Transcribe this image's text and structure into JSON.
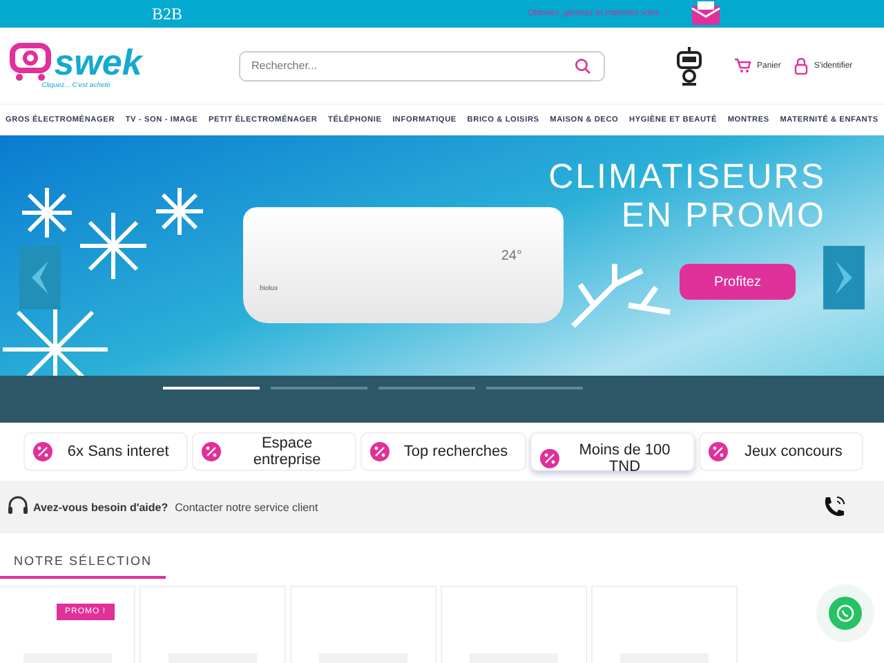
{
  "top_bar": {
    "b2b": "B2B",
    "promo_text": "Obtenez, générez et imprimez votre ..."
  },
  "header": {
    "logo": "swek",
    "tagline": "Cliquez... C'est acheté",
    "search": {
      "placeholder": "Rechercher..."
    },
    "cart": "Panier",
    "login": "S'identifier"
  },
  "nav": [
    "GROS ÉLECTROMÉNAGER",
    "TV - SON - IMAGE",
    "PETIT ÉLECTROMÉNAGER",
    "TÉLÉPHONIE",
    "INFORMATIQUE",
    "BRICO & LOISIRS",
    "MAISON & DECO",
    "HYGIÈNE ET BEAUTÉ",
    "MONTRES",
    "MATERNITÉ & ENFANTS"
  ],
  "banner": {
    "title_1": "CLIMATISEURS",
    "title_2": "EN PROMO",
    "button": "Profitez",
    "display": "24°",
    "brand": "biolux",
    "slides": [
      {
        "selected": true
      },
      {
        "selected": false
      },
      {
        "selected": false
      },
      {
        "selected": false
      }
    ]
  },
  "quick_links": [
    {
      "label": "6x Sans interet",
      "selected": false
    },
    {
      "label": "Espace entreprise",
      "selected": false
    },
    {
      "label": "Top recherches",
      "selected": false
    },
    {
      "label": "Moins de 100 TND",
      "selected": true
    },
    {
      "label": "Jeux concours",
      "selected": false
    }
  ],
  "help": {
    "question": "Avez-vous besoin d'aide?",
    "link": "Contacter notre service client"
  },
  "selection": {
    "title": "NOTRE SÉLECTION",
    "products": [
      {
        "kind": "promo",
        "badge": "PROMO !"
      },
      {
        "kind": "plain"
      },
      {
        "kind": "plain"
      },
      {
        "kind": "plain"
      },
      {
        "kind": "plain"
      }
    ]
  }
}
